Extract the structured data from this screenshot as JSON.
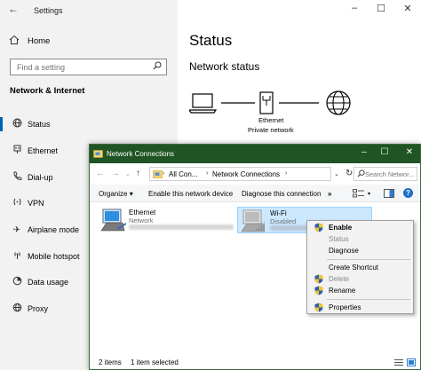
{
  "settings": {
    "title": "Settings",
    "home_label": "Home",
    "search_placeholder": "Find a setting",
    "section_header": "Network & Internet",
    "nav_items": [
      {
        "label": "Status",
        "icon": "globe-icon",
        "selected": true
      },
      {
        "label": "Ethernet",
        "icon": "ethernet-icon",
        "selected": false
      },
      {
        "label": "Dial-up",
        "icon": "phone-icon",
        "selected": false
      },
      {
        "label": "VPN",
        "icon": "vpn-icon",
        "selected": false
      },
      {
        "label": "Airplane mode",
        "icon": "airplane-icon",
        "selected": false
      },
      {
        "label": "Mobile hotspot",
        "icon": "hotspot-icon",
        "selected": false
      },
      {
        "label": "Data usage",
        "icon": "data-usage-icon",
        "selected": false
      },
      {
        "label": "Proxy",
        "icon": "proxy-icon",
        "selected": false
      }
    ],
    "main": {
      "heading": "Status",
      "subheading": "Network status",
      "connection_name": "Ethernet",
      "connection_type": "Private network"
    }
  },
  "network_connections": {
    "title": "Network Connections",
    "breadcrumbs": [
      "All Con...",
      "Network Connections"
    ],
    "search_placeholder": "Search Networ...",
    "toolbar": {
      "organize": "Organize",
      "enable_device": "Enable this network device",
      "diagnose": "Diagnose this connection",
      "more": "»"
    },
    "connections": [
      {
        "name": "Ethernet",
        "status": "Network",
        "selected": false
      },
      {
        "name": "Wi-Fi",
        "status": "Disabled",
        "selected": true
      }
    ],
    "statusbar": {
      "count": "2 items",
      "selected": "1 item selected"
    }
  },
  "context_menu": {
    "items": [
      {
        "label": "Enable",
        "shield": true,
        "disabled": false,
        "bold": true
      },
      {
        "label": "Status",
        "shield": false,
        "disabled": true,
        "bold": false
      },
      {
        "label": "Diagnose",
        "shield": false,
        "disabled": false,
        "bold": false
      },
      {
        "label": "Create Shortcut",
        "shield": false,
        "disabled": false,
        "bold": false
      },
      {
        "label": "Delete",
        "shield": true,
        "disabled": true,
        "bold": false
      },
      {
        "label": "Rename",
        "shield": true,
        "disabled": false,
        "bold": false
      },
      {
        "label": "Properties",
        "shield": true,
        "disabled": false,
        "bold": false
      }
    ]
  },
  "colors": {
    "accent": "#0063b1",
    "netconn_titlebar": "#1f5424",
    "selection_fill": "#cce8ff"
  }
}
